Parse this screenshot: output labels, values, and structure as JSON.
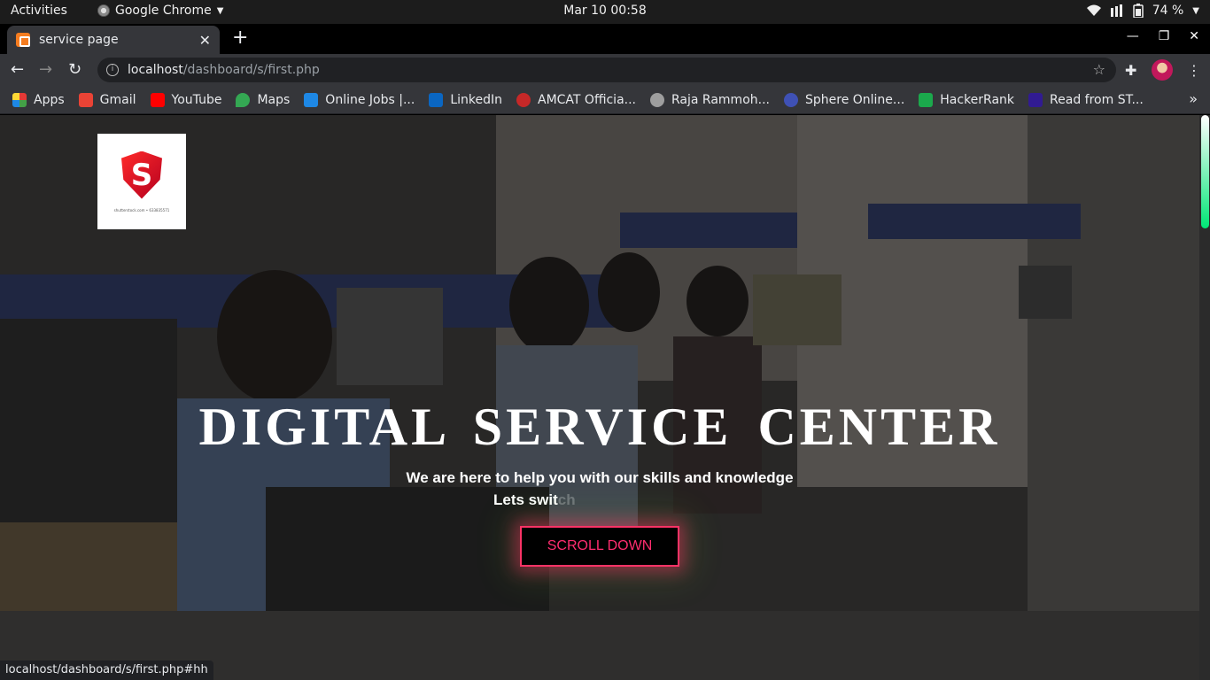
{
  "system": {
    "activities": "Activities",
    "app_name": "Google Chrome",
    "clock": "Mar 10  00:58",
    "battery": "74 %"
  },
  "browser": {
    "tab_title": "service page",
    "url_host": "localhost",
    "url_path": "/dashboard/s/first.php",
    "status_url": "localhost/dashboard/s/first.php#hh"
  },
  "bookmarks": [
    {
      "label": "Apps",
      "color": "#e53935"
    },
    {
      "label": "Gmail",
      "color": "#ea4335"
    },
    {
      "label": "YouTube",
      "color": "#ff0000"
    },
    {
      "label": "Maps",
      "color": "#34a853"
    },
    {
      "label": "Online Jobs |...",
      "color": "#1e88e5"
    },
    {
      "label": "LinkedIn",
      "color": "#0a66c2"
    },
    {
      "label": "AMCAT Officia...",
      "color": "#c62828"
    },
    {
      "label": "Raja Rammoh...",
      "color": "#9e9e9e"
    },
    {
      "label": "Sphere Online...",
      "color": "#3f51b5"
    },
    {
      "label": "HackerRank",
      "color": "#1ba94c"
    },
    {
      "label": "Read from ST...",
      "color": "#311b92"
    }
  ],
  "hero": {
    "title": "DIGITAL  SERVICE  CENTER",
    "subtitle": "We are here to help you with our skills and knowledge",
    "typing_visible": "Lets swit",
    "typing_fading": "ch",
    "button_label": "SCROLL DOWN",
    "logo_caption": "shutterstock.com • 633835571"
  },
  "colors": {
    "accent": "#ff2d6f",
    "scroll_thumb": "#00e676"
  }
}
